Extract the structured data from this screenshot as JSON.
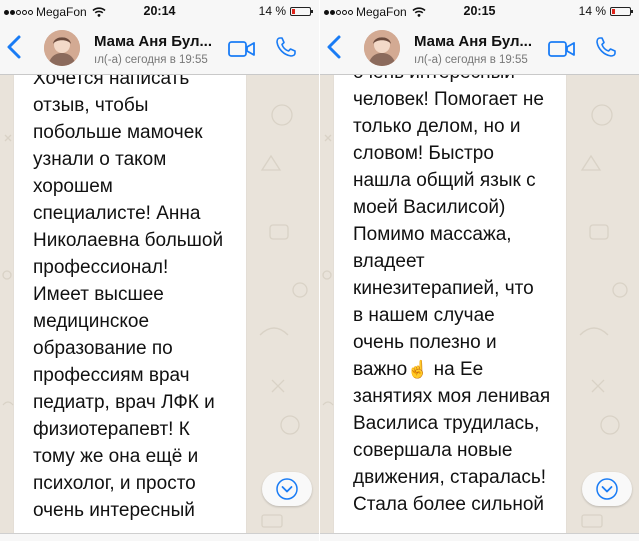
{
  "left": {
    "status": {
      "carrier": "MegaFon",
      "time": "20:14",
      "battery": "14 %",
      "battery_level": 0.14
    },
    "header": {
      "contact_name": "Мама Аня Бул...",
      "last_seen": "ıл(-а) сегодня в 19:55"
    },
    "lines": [
      "Хочется написать",
      "отзыв, чтобы",
      "побольше мамочек",
      "узнали о таком",
      "хорошем",
      "специалисте! Анна",
      "Николаевна большой",
      "профессионал!",
      "Имеет высшее",
      "медицинское",
      "образование по",
      "профессиям врач",
      "педиатр, врач ЛФК и",
      "физиотерапевт! К",
      "тому же она ещё и",
      "психолог, и просто",
      "очень интересный"
    ]
  },
  "right": {
    "status": {
      "carrier": "MegaFon",
      "time": "20:15",
      "battery": "14 %",
      "battery_level": 0.14
    },
    "header": {
      "contact_name": "Мама Аня Бул...",
      "last_seen": "ıл(-а) сегодня в 19:55"
    },
    "lines": [
      "очень интересный",
      "человек! Помогает не",
      "только делом, но и",
      "словом! Быстро",
      "нашла общий язык с",
      "моей Василисой)",
      "Помимо массажа,",
      "владеет",
      "кинезитерапией, что",
      "в нашем случае",
      "очень полезно и",
      "важно",
      "на Ее",
      "занятиях моя ленивая",
      "Василиса трудилась,",
      "совершала новые",
      "движения, старалась!",
      "Стала более сильной"
    ],
    "emoji": "☝",
    "emoji_name": "pointing-up-hand-icon"
  },
  "icons": [
    "back-chevron-icon",
    "video-call-icon",
    "phone-call-icon",
    "scroll-down-icon",
    "wifi-icon",
    "battery-icon"
  ],
  "colors": {
    "accent": "#1a7cf5",
    "battery_low": "#e0241a",
    "chat_bg": "#e9e3da",
    "bar_bg": "#f7f7f7"
  }
}
